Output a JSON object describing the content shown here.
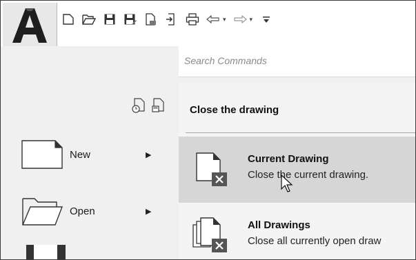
{
  "app": {
    "logo_letter": "A"
  },
  "quick_access": {
    "icons": [
      "new-file-icon",
      "open-folder-icon",
      "save-icon",
      "save-as-icon",
      "export-icon",
      "import-icon",
      "print-icon",
      "undo-icon",
      "redo-icon",
      "customize-dropdown-icon"
    ]
  },
  "search": {
    "placeholder": "Search Commands"
  },
  "left_menu": {
    "items": [
      {
        "label": "New",
        "has_submenu": true
      },
      {
        "label": "Open",
        "has_submenu": true
      }
    ]
  },
  "right_panel": {
    "title": "Close the drawing",
    "items": [
      {
        "title": "Current Drawing",
        "description": "Close the current drawing.",
        "active": true
      },
      {
        "title": "All Drawings",
        "description": "Close all currently open draw",
        "active": false
      }
    ]
  },
  "colors": {
    "left_bg": "#f0f0f0",
    "panel_bg": "#f4f4f4",
    "active_row": "#d6d6d6",
    "close_badge": "#555555"
  }
}
